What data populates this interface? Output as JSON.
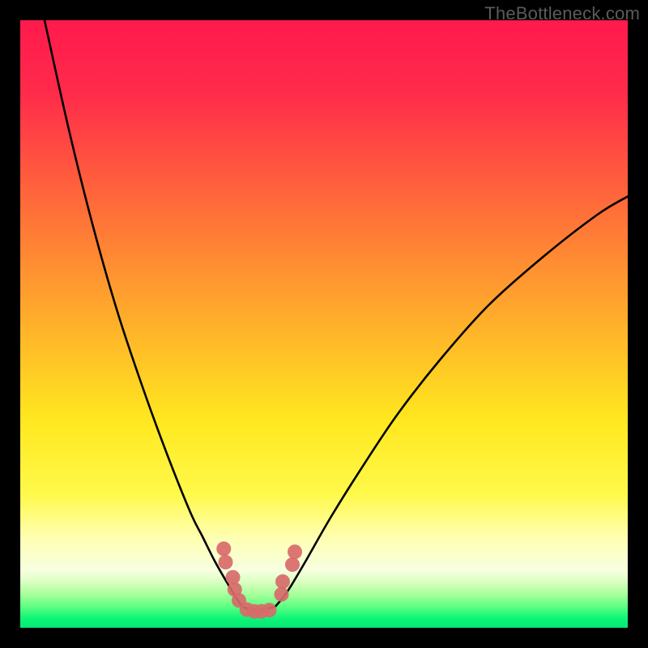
{
  "watermark": "TheBottleneck.com",
  "chart_data": {
    "type": "line",
    "title": "",
    "xlabel": "",
    "ylabel": "",
    "xlim": [
      0,
      100
    ],
    "ylim": [
      0,
      100
    ],
    "grid": false,
    "legend": false,
    "background_gradient": {
      "stops": [
        {
          "pos": 0.0,
          "color": "#ff1a4d"
        },
        {
          "pos": 0.12,
          "color": "#ff2b4a"
        },
        {
          "pos": 0.3,
          "color": "#ff6a3a"
        },
        {
          "pos": 0.5,
          "color": "#ffb02a"
        },
        {
          "pos": 0.66,
          "color": "#ffe81f"
        },
        {
          "pos": 0.78,
          "color": "#fff94a"
        },
        {
          "pos": 0.85,
          "color": "#ffffb0"
        },
        {
          "pos": 0.905,
          "color": "#f7ffe0"
        },
        {
          "pos": 0.925,
          "color": "#d9ffc0"
        },
        {
          "pos": 0.945,
          "color": "#a6ff9a"
        },
        {
          "pos": 0.965,
          "color": "#5eff82"
        },
        {
          "pos": 0.985,
          "color": "#0cf576"
        },
        {
          "pos": 1.0,
          "color": "#05e877"
        }
      ]
    },
    "series": [
      {
        "name": "left-branch",
        "x": [
          4,
          8,
          12,
          16,
          20,
          24,
          28,
          30,
          32,
          34,
          35.5,
          36.5
        ],
        "y": [
          100,
          82,
          66,
          52,
          40,
          29,
          19,
          15,
          11,
          7.5,
          5,
          3.5
        ]
      },
      {
        "name": "right-branch",
        "x": [
          42,
          44,
          47,
          51,
          56,
          62,
          69,
          77,
          86,
          95,
          100
        ],
        "y": [
          3.5,
          6,
          11,
          18,
          26,
          35,
          44,
          53,
          61,
          68,
          71
        ]
      },
      {
        "name": "valley-floor",
        "x": [
          36.5,
          38,
          40,
          42
        ],
        "y": [
          3.5,
          3,
          3,
          3.5
        ]
      }
    ],
    "markers": {
      "name": "data-points",
      "color": "#d86a6a",
      "x": [
        33.5,
        33.8,
        35.0,
        35.3,
        36.0,
        37.3,
        38.5,
        39.7,
        41.0,
        43.0,
        43.2,
        44.8,
        45.2
      ],
      "y": [
        13.0,
        10.8,
        8.3,
        6.3,
        4.5,
        3.0,
        2.7,
        2.7,
        2.9,
        5.5,
        7.6,
        10.4,
        12.5
      ]
    }
  }
}
